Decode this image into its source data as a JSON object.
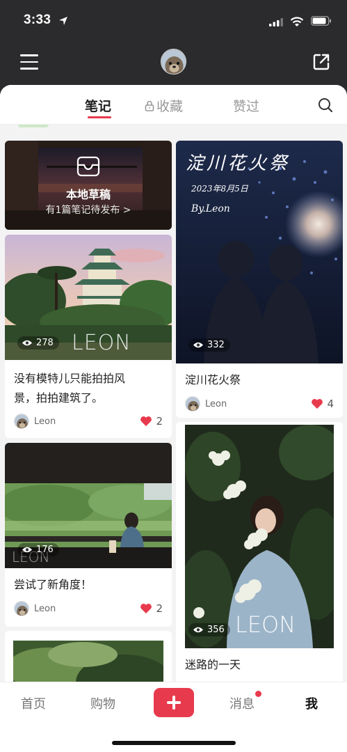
{
  "status_bar": {
    "time": "3:33"
  },
  "tabs": {
    "notes": "笔记",
    "collect": "收藏",
    "liked": "赞过"
  },
  "draft": {
    "title": "本地草稿",
    "subtitle": "有1篇笔记待发布 >"
  },
  "notes": [
    {
      "title_line1": "没有模特儿只能拍拍风",
      "title_line2": "景，拍拍建筑了。",
      "views": "278",
      "author": "Leon",
      "likes": "2",
      "watermark": "LEON"
    },
    {
      "title": "淀川花火祭",
      "views": "332",
      "author": "Leon",
      "likes": "4",
      "image_text_1": "淀川花火祭",
      "image_text_2": "2023年8月5日",
      "image_text_3": "By.Leon"
    },
    {
      "title": "尝试了新角度！",
      "views": "176",
      "author": "Leon",
      "likes": "2",
      "watermark": "LEON"
    },
    {
      "title": "迷路的一天",
      "views": "356",
      "watermark": "LEON"
    }
  ],
  "bottom_nav": {
    "home": "首页",
    "shop": "购物",
    "messages": "消息",
    "me": "我"
  },
  "colors": {
    "accent": "#e83a4d",
    "top_bg": "#2b2b2d"
  }
}
